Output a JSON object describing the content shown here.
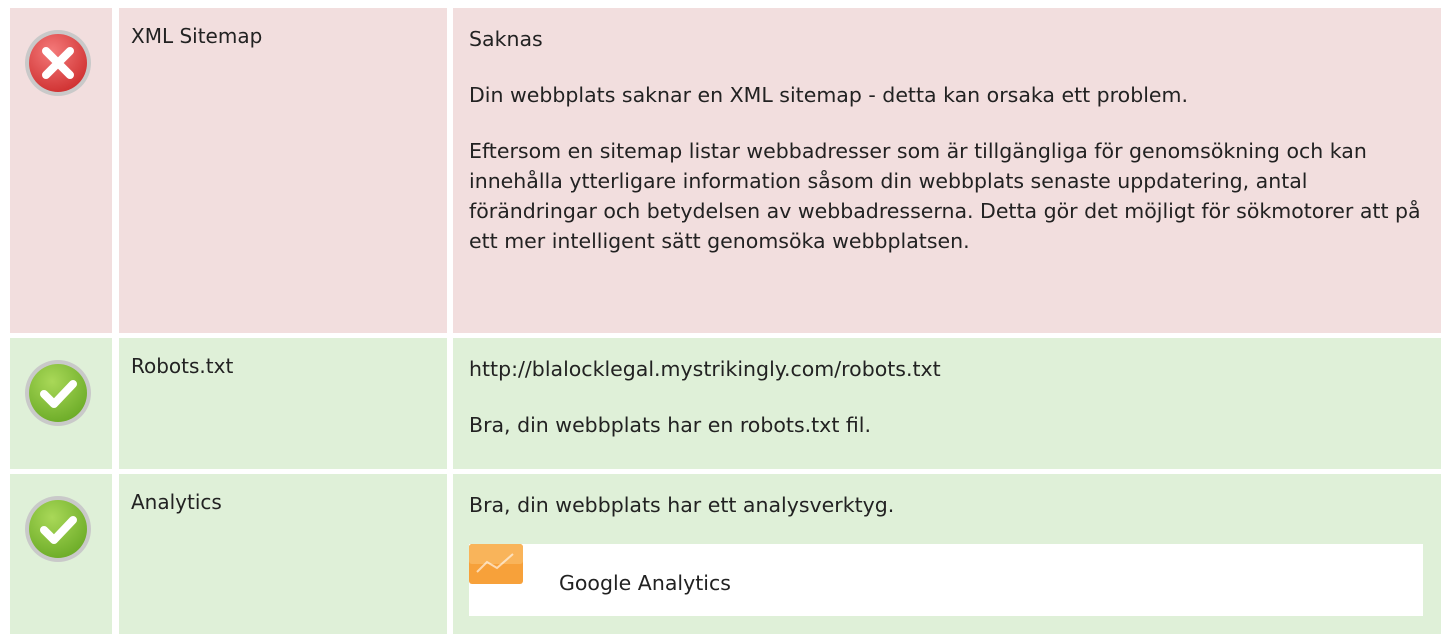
{
  "rows": [
    {
      "status": "fail",
      "icon": "error-x-icon",
      "label": "XML Sitemap",
      "lines": [
        "Saknas",
        "Din webbplats saknar en XML sitemap - detta kan orsaka ett problem.",
        "Eftersom en sitemap listar webbadresser som är tillgängliga för genomsökning och kan innehålla ytterligare information såsom din webbplats senaste uppdatering, antal förändringar och betydelsen av webbadresserna. Detta gör det möjligt för sökmotorer att på ett mer intelligent sätt genomsöka webbplatsen."
      ]
    },
    {
      "status": "ok",
      "icon": "check-icon",
      "label": "Robots.txt",
      "lines": [
        "http://blalocklegal.mystrikingly.com/robots.txt",
        "Bra, din webbplats har en robots.txt fil."
      ]
    },
    {
      "status": "ok",
      "icon": "check-icon",
      "label": "Analytics",
      "lines": [
        "Bra, din webbplats har ett analysverktyg."
      ],
      "tool": {
        "icon": "google-analytics-icon",
        "name": "Google Analytics"
      }
    }
  ],
  "colors": {
    "fail_bg": "#f2dede",
    "ok_bg": "#dff0d8",
    "fail_icon": "#e14b4b",
    "ok_icon": "#8dc63f",
    "analytics_orange": "#f7a13a"
  }
}
